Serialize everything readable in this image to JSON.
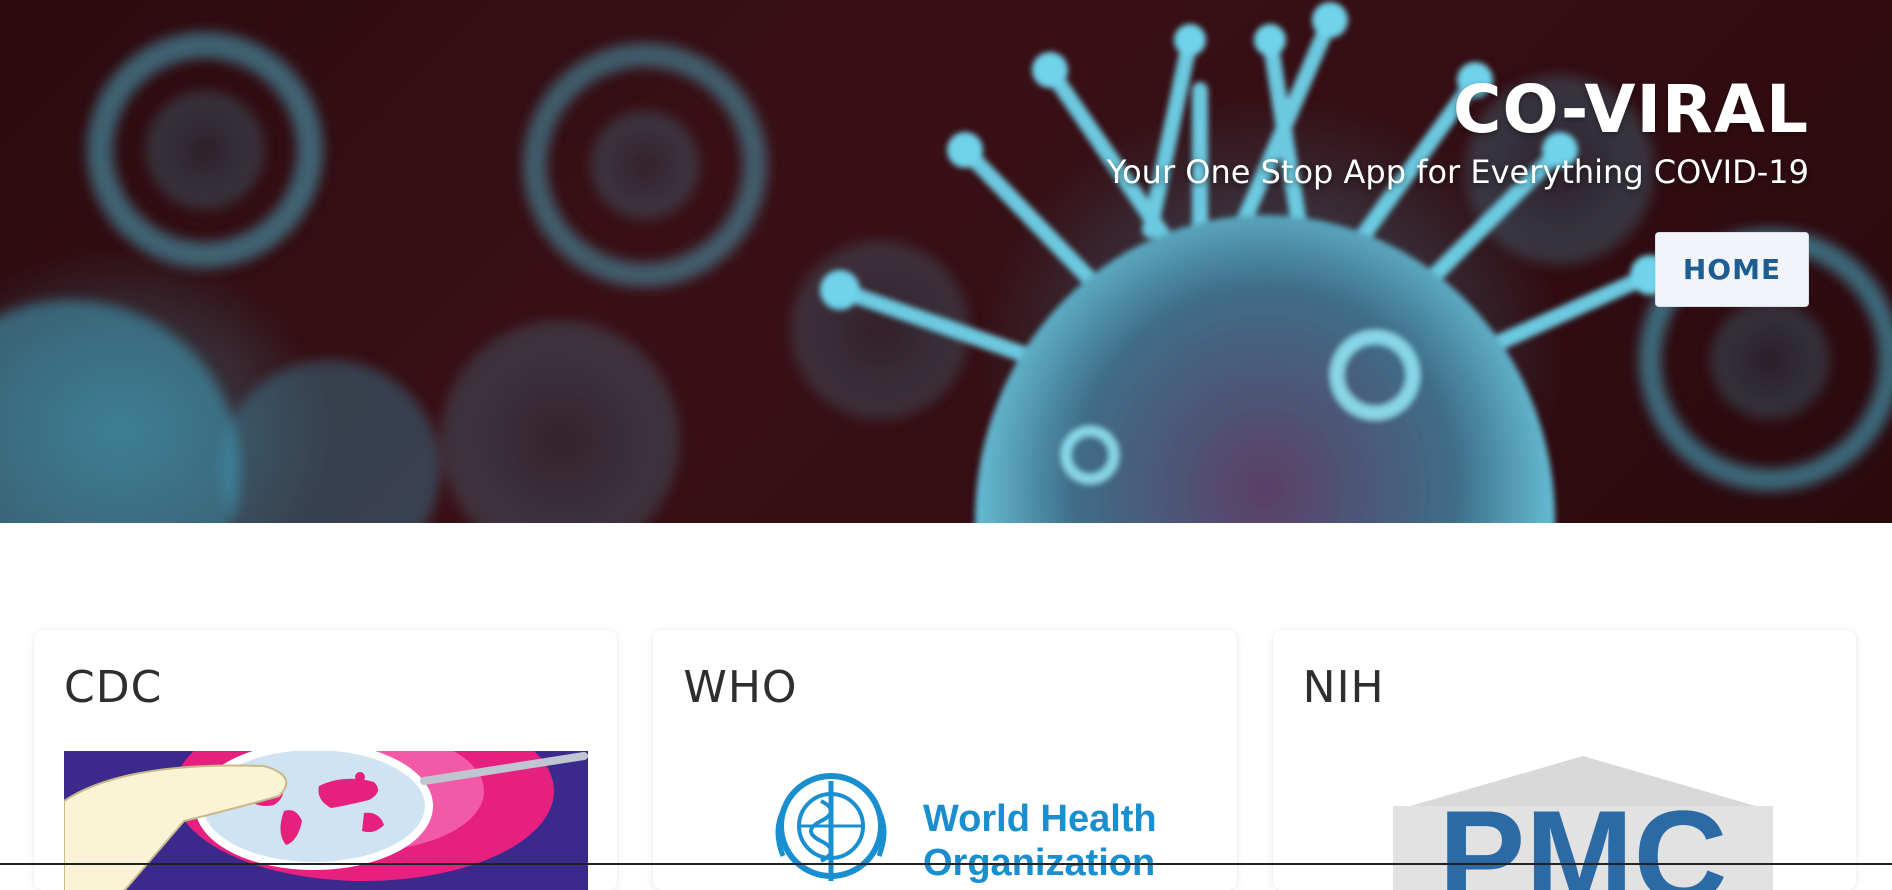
{
  "hero": {
    "title": "CO-VIRAL",
    "subtitle": "Your One Stop App for Everything COVID-19",
    "home_button": "HOME"
  },
  "cards": [
    {
      "title": "CDC",
      "image": "petri-dish-world-map-image"
    },
    {
      "title": "WHO",
      "image": "who-logo",
      "logo_text_line1": "World Health",
      "logo_text_line2": "Organization"
    },
    {
      "title": "NIH",
      "image": "pmc-logo",
      "logo_text": "PMC"
    }
  ],
  "colors": {
    "hero_dark": "#2b0b10",
    "virus_teal": "#5ec6dd",
    "button_text": "#1e5d91",
    "who_blue": "#1a8fd0",
    "pmc_blue": "#2c6aa6",
    "cdc_pink": "#e6207f",
    "cdc_purple": "#3b2a8c"
  }
}
